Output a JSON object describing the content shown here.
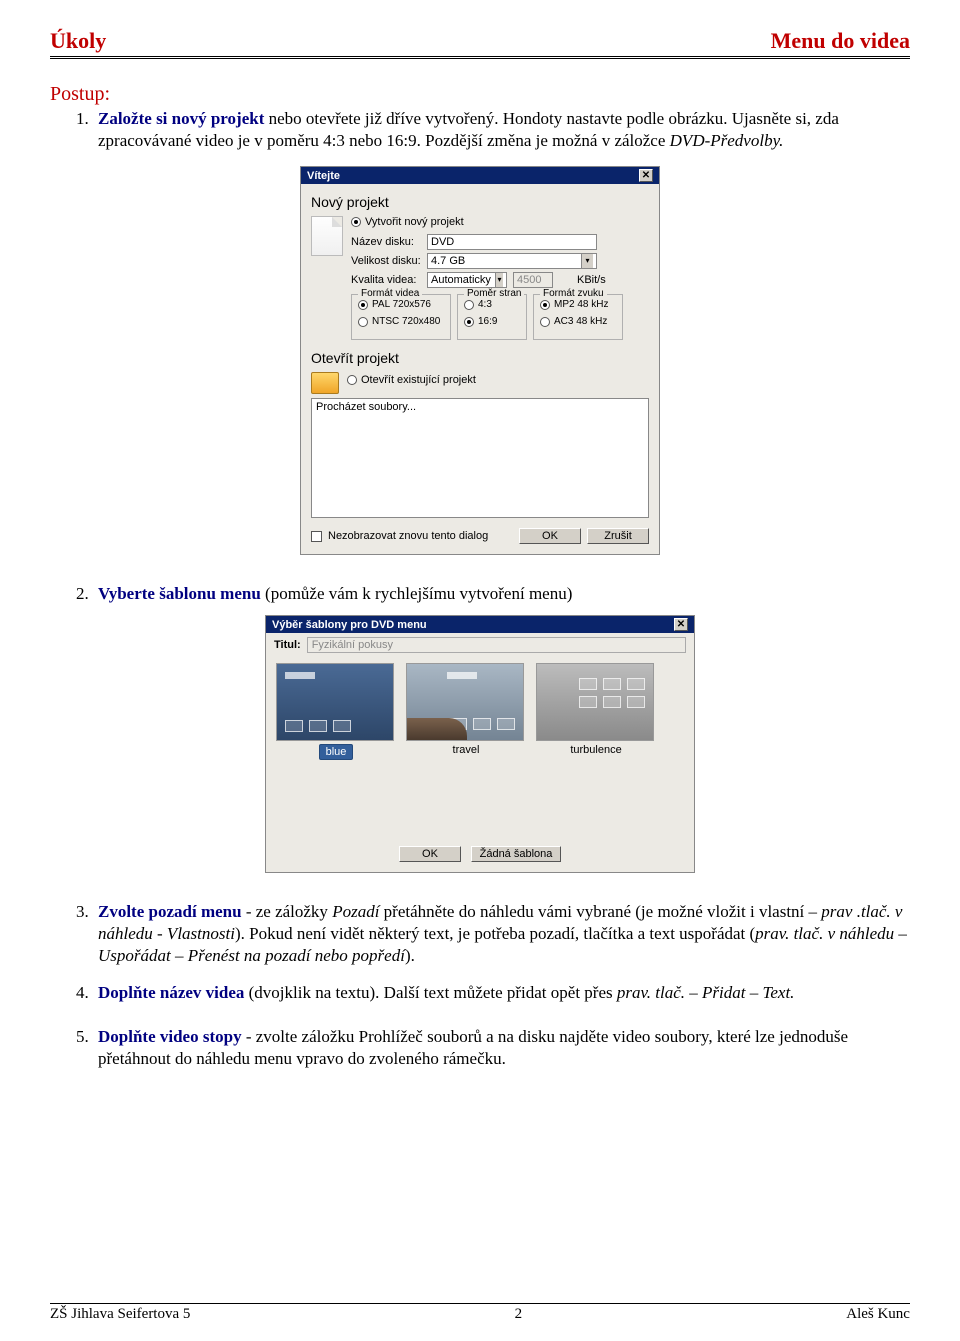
{
  "header": {
    "left": "Úkoly",
    "right": "Menu do videa"
  },
  "postup_label": "Postup:",
  "steps": {
    "s1": {
      "num": "1.",
      "bold": "Založte si nový projekt",
      "rest_a": " nebo otevřete již dříve vytvořený. Hondoty nastavte podle obrázku. Ujasněte si, zda zpracovávané video je v poměru 4:3 nebo 16:9. Pozdější změna je možná v záložce ",
      "rest_b_italic": "DVD-Předvolby.",
      "rest_c": ""
    },
    "s2": {
      "num": "2.",
      "bold": "Vyberte šablonu menu",
      "rest": " (pomůže vám k rychlejšímu vytvoření menu)"
    },
    "s3": {
      "num": "3.",
      "bold": "Zvolte pozadí menu",
      "rest_a": " - ze záložky ",
      "it1": "Pozadí",
      "rest_b": " přetáhněte do náhledu vámi vybrané (je možné vložit i vlastní – ",
      "it2": "prav .tlač. v náhledu - Vlastnosti",
      "rest_c": "). Pokud není vidět některý text, je potřeba pozadí, tlačítka a text uspořádat (",
      "it3": "prav. tlač. v náhledu – Uspořádat – Přenést na pozadí nebo popředí",
      "rest_d": ")."
    },
    "s4": {
      "num": "4.",
      "bold": "Doplňte název videa",
      "rest_a": " (dvojklik na textu). Další text můžete přidat opět přes ",
      "it1": "prav. tlač. – Přidat – Text.",
      "rest_b": ""
    },
    "s5": {
      "num": "5.",
      "bold": "Doplňte video stopy",
      "rest": " - zvolte záložku Prohlížeč souborů a na disku najděte video soubory, které lze jednoduše přetáhnout do náhledu menu vpravo do zvoleného rámečku."
    }
  },
  "dlg1": {
    "title": "Vítejte",
    "section_new": "Nový projekt",
    "create_radio": "Vytvořit nový projekt",
    "name_lbl": "Název disku:",
    "name_val": "DVD",
    "size_lbl": "Velikost disku:",
    "size_val": "4.7 GB",
    "qual_lbl": "Kvalita videa:",
    "qual_val": "Automaticky",
    "bitrate_val": "4500",
    "bitrate_unit": "KBit/s",
    "grp_video_title": "Formát videa",
    "grp_video_opt1": "PAL 720x576",
    "grp_video_opt2": "NTSC 720x480",
    "grp_aspect_title": "Poměr stran",
    "grp_aspect_opt1": "4:3",
    "grp_aspect_opt2": "16:9",
    "grp_audio_title": "Formát zvuku",
    "grp_audio_opt1": "MP2 48 kHz",
    "grp_audio_opt2": "AC3 48 kHz",
    "section_open": "Otevřít projekt",
    "open_radio": "Otevřít existující projekt",
    "browse": "Procházet soubory...",
    "dont_show": "Nezobrazovat znovu tento dialog",
    "ok": "OK",
    "cancel": "Zrušit"
  },
  "dlg2": {
    "title": "Výběr šablony pro DVD menu",
    "titul_lbl": "Titul:",
    "titul_val": "Fyzikální pokusy",
    "t1": "blue",
    "t2": "travel",
    "t3": "turbulence",
    "ok": "OK",
    "no_tpl": "Žádná šablona"
  },
  "footer": {
    "left": "ZŠ Jihlava Seifertova 5",
    "center": "2",
    "right": "Aleš Kunc"
  }
}
